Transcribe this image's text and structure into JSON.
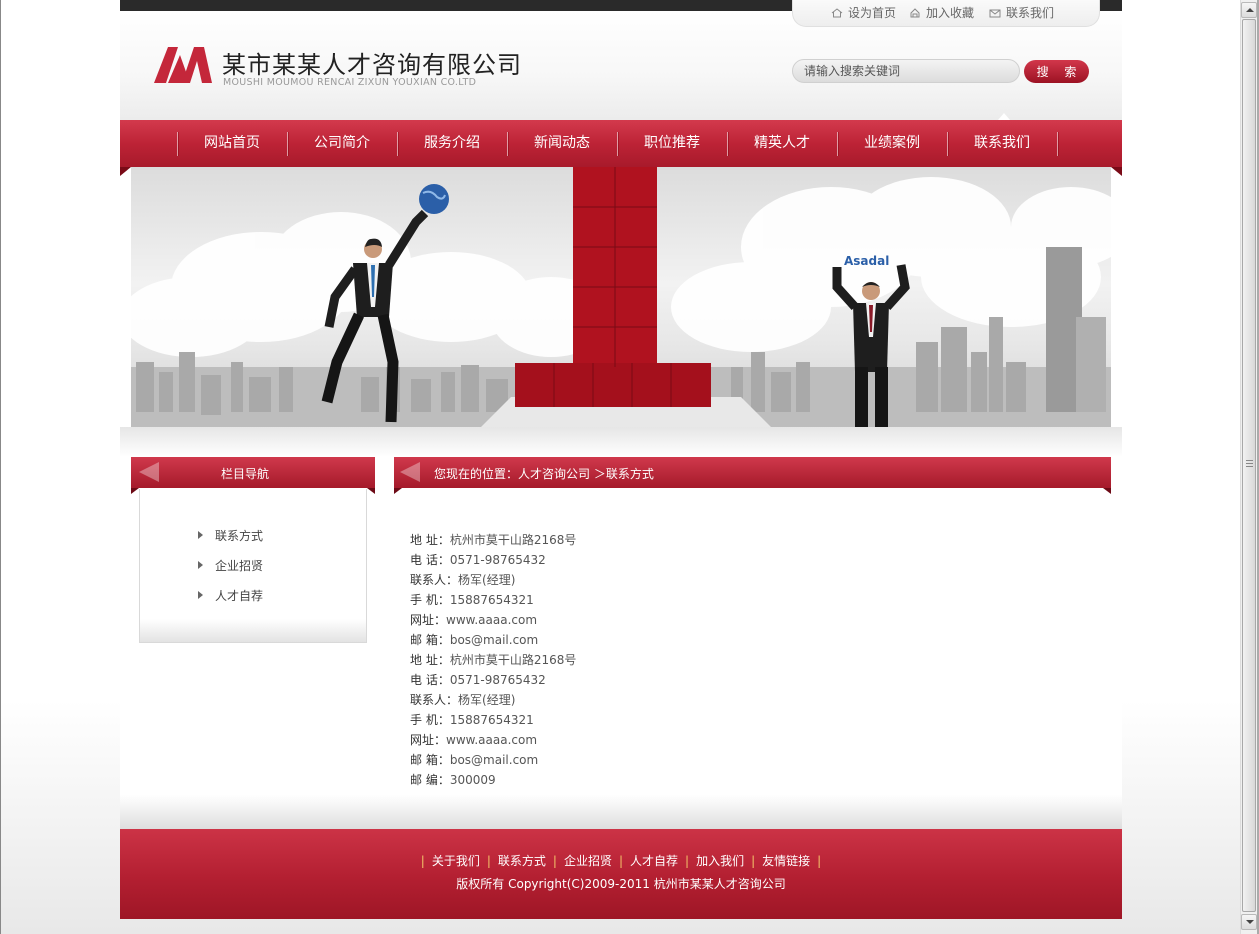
{
  "header": {
    "company_name": "某市某某人才咨询有限公司",
    "company_pinyin": "MOUSHI MOUMOU RENCAI ZIXUN YOUXIAN CO.LTD",
    "top_links": [
      "设为首页",
      "加入收藏",
      "联系我们"
    ],
    "search_placeholder": "请输入搜索关键词",
    "search_button": "搜 索"
  },
  "nav": {
    "items": [
      "网站首页",
      "公司简介",
      "服务介绍",
      "新闻动态",
      "职位推荐",
      "精英人才",
      "业绩案例",
      "联系我们"
    ]
  },
  "banner": {
    "sign_text": "Asadal"
  },
  "sidebar": {
    "title": "栏目导航",
    "items": [
      "联系方式",
      "企业招贤",
      "人才自荐"
    ]
  },
  "content": {
    "breadcrumb_prefix": "您现在的位置：",
    "breadcrumb_home": "人才咨询公司",
    "breadcrumb_sep": " ＞",
    "breadcrumb_current": "联系方式",
    "contact": [
      {
        "label": "地 址：",
        "value": "杭州市莫干山路2168号"
      },
      {
        "label": "电 话：",
        "value": "0571-98765432"
      },
      {
        "label": "联系人：",
        "value": "杨军(经理)"
      },
      {
        "label": "手 机：",
        "value": "15887654321"
      },
      {
        "label": "网址：",
        "value": "www.aaaa.com"
      },
      {
        "label": "邮 箱：",
        "value": "bos@mail.com"
      },
      {
        "label": "地 址：",
        "value": "杭州市莫干山路2168号"
      },
      {
        "label": "电 话：",
        "value": "0571-98765432"
      },
      {
        "label": "联系人：",
        "value": "杨军(经理)"
      },
      {
        "label": "手 机：",
        "value": "15887654321"
      },
      {
        "label": "网址：",
        "value": "www.aaaa.com"
      },
      {
        "label": "邮 箱：",
        "value": "bos@mail.com"
      },
      {
        "label": "邮 编：",
        "value": "300009"
      }
    ]
  },
  "footer": {
    "links": [
      "关于我们",
      "联系方式",
      "企业招贤",
      "人才自荐",
      "加入我们",
      "友情链接"
    ],
    "copyright": "版权所有  Copyright(C)2009-2011 杭州市某某人才咨询公司"
  },
  "colors": {
    "brand_red": "#b8202f",
    "separator_gold": "#f3c46a",
    "top_bar": "#2a2a2a"
  }
}
